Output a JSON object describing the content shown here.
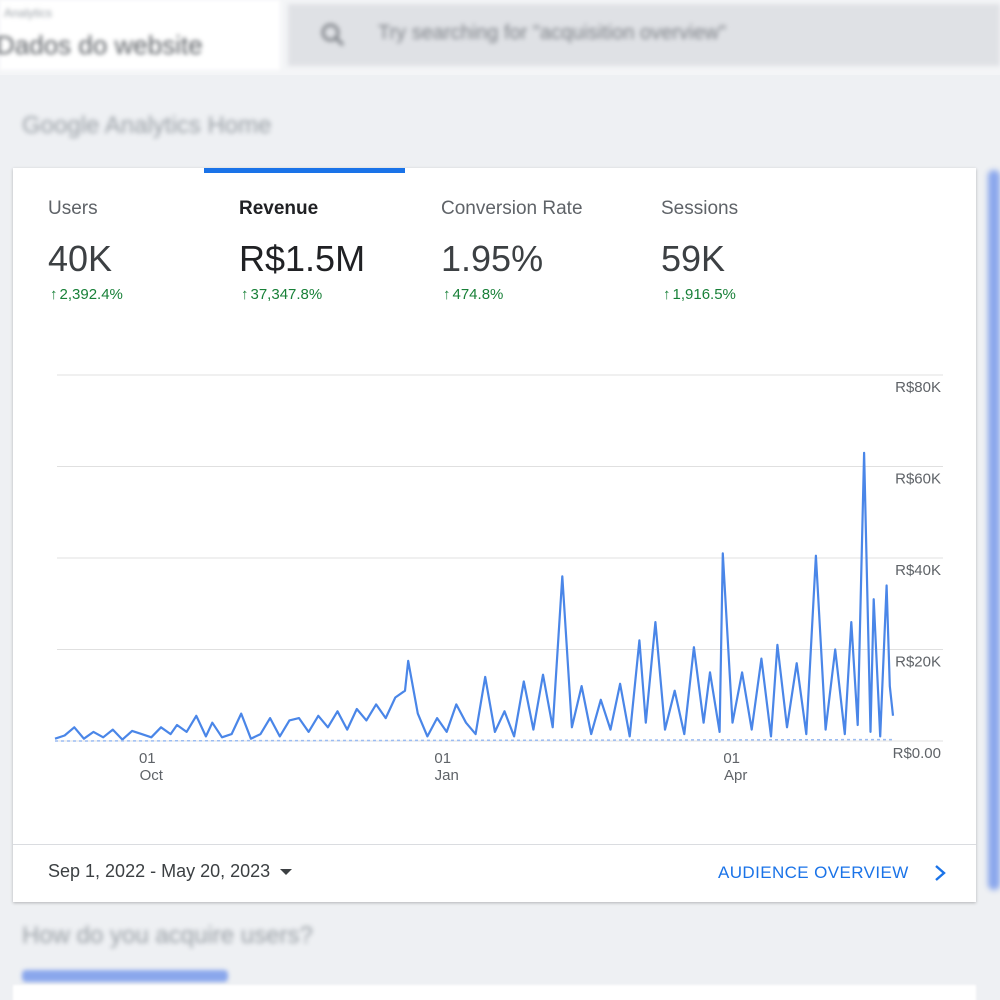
{
  "header": {
    "property_small": "Analytics",
    "property_name": "Dados do website",
    "search_placeholder": "Try searching for \"acquisition overview\""
  },
  "section_title": "Google Analytics Home",
  "metrics": [
    {
      "label": "Users",
      "value": "40K",
      "change": "2,392.4%",
      "active": false
    },
    {
      "label": "Revenue",
      "value": "R$1.5M",
      "change": "37,347.8%",
      "active": true
    },
    {
      "label": "Conversion Rate",
      "value": "1.95%",
      "change": "474.8%",
      "active": false
    },
    {
      "label": "Sessions",
      "value": "59K",
      "change": "1,916.5%",
      "active": false
    }
  ],
  "colors": {
    "accent": "#1a73e8",
    "line": "#4a86e8",
    "positive": "#188038"
  },
  "footer": {
    "date_range": "Sep 1, 2022 - May 20, 2023",
    "audience_link": "AUDIENCE OVERVIEW"
  },
  "bottom_section_title": "How do you acquire users?",
  "chart_data": {
    "type": "line",
    "title": "",
    "xlabel": "",
    "ylabel": "",
    "x_start": "2022-09-01",
    "x_end": "2023-05-20",
    "xticks": [
      {
        "date": "2022-10-01",
        "day": "01",
        "month": "Oct"
      },
      {
        "date": "2023-01-01",
        "day": "01",
        "month": "Jan"
      },
      {
        "date": "2023-04-01",
        "day": "01",
        "month": "Apr"
      }
    ],
    "yticks": [
      {
        "value": 0,
        "label": "R$0.00"
      },
      {
        "value": 20000,
        "label": "R$20K"
      },
      {
        "value": 40000,
        "label": "R$40K"
      },
      {
        "value": 60000,
        "label": "R$60K"
      },
      {
        "value": 80000,
        "label": "R$80K"
      }
    ],
    "ylim": [
      0,
      80000
    ],
    "grid": true,
    "series": [
      {
        "comparison": false,
        "points": [
          [
            "2022-09-01",
            500
          ],
          [
            "2022-09-04",
            1200
          ],
          [
            "2022-09-07",
            3000
          ],
          [
            "2022-09-10",
            500
          ],
          [
            "2022-09-13",
            2000
          ],
          [
            "2022-09-16",
            800
          ],
          [
            "2022-09-19",
            2500
          ],
          [
            "2022-09-22",
            300
          ],
          [
            "2022-09-25",
            2200
          ],
          [
            "2022-09-28",
            1500
          ],
          [
            "2022-10-01",
            800
          ],
          [
            "2022-10-04",
            3000
          ],
          [
            "2022-10-07",
            1500
          ],
          [
            "2022-10-09",
            3500
          ],
          [
            "2022-10-12",
            2000
          ],
          [
            "2022-10-15",
            5500
          ],
          [
            "2022-10-18",
            1000
          ],
          [
            "2022-10-20",
            4000
          ],
          [
            "2022-10-23",
            800
          ],
          [
            "2022-10-26",
            1500
          ],
          [
            "2022-10-29",
            6000
          ],
          [
            "2022-11-01",
            500
          ],
          [
            "2022-11-04",
            1500
          ],
          [
            "2022-11-07",
            5000
          ],
          [
            "2022-11-10",
            1000
          ],
          [
            "2022-11-13",
            4500
          ],
          [
            "2022-11-16",
            5000
          ],
          [
            "2022-11-19",
            2000
          ],
          [
            "2022-11-22",
            5500
          ],
          [
            "2022-11-25",
            3000
          ],
          [
            "2022-11-28",
            6500
          ],
          [
            "2022-12-01",
            2500
          ],
          [
            "2022-12-04",
            7000
          ],
          [
            "2022-12-07",
            4500
          ],
          [
            "2022-12-10",
            8000
          ],
          [
            "2022-12-13",
            5000
          ],
          [
            "2022-12-16",
            9500
          ],
          [
            "2022-12-19",
            11000
          ],
          [
            "2022-12-20",
            17500
          ],
          [
            "2022-12-23",
            6000
          ],
          [
            "2022-12-26",
            1000
          ],
          [
            "2022-12-29",
            5000
          ],
          [
            "2023-01-01",
            2000
          ],
          [
            "2023-01-04",
            8000
          ],
          [
            "2023-01-07",
            4000
          ],
          [
            "2023-01-10",
            1500
          ],
          [
            "2023-01-13",
            14000
          ],
          [
            "2023-01-16",
            2000
          ],
          [
            "2023-01-19",
            6500
          ],
          [
            "2023-01-22",
            1000
          ],
          [
            "2023-01-25",
            13000
          ],
          [
            "2023-01-28",
            2500
          ],
          [
            "2023-01-31",
            14500
          ],
          [
            "2023-02-03",
            3000
          ],
          [
            "2023-02-06",
            36000
          ],
          [
            "2023-02-09",
            3000
          ],
          [
            "2023-02-12",
            12000
          ],
          [
            "2023-02-15",
            1500
          ],
          [
            "2023-02-18",
            9000
          ],
          [
            "2023-02-21",
            2500
          ],
          [
            "2023-02-24",
            12500
          ],
          [
            "2023-02-27",
            1000
          ],
          [
            "2023-03-02",
            22000
          ],
          [
            "2023-03-04",
            4000
          ],
          [
            "2023-03-07",
            26000
          ],
          [
            "2023-03-10",
            2500
          ],
          [
            "2023-03-13",
            11000
          ],
          [
            "2023-03-16",
            1500
          ],
          [
            "2023-03-19",
            20500
          ],
          [
            "2023-03-22",
            4000
          ],
          [
            "2023-03-24",
            15000
          ],
          [
            "2023-03-27",
            2000
          ],
          [
            "2023-03-28",
            41000
          ],
          [
            "2023-03-31",
            4000
          ],
          [
            "2023-04-03",
            15000
          ],
          [
            "2023-04-06",
            2500
          ],
          [
            "2023-04-09",
            18000
          ],
          [
            "2023-04-12",
            1000
          ],
          [
            "2023-04-14",
            21000
          ],
          [
            "2023-04-17",
            3000
          ],
          [
            "2023-04-20",
            17000
          ],
          [
            "2023-04-23",
            1500
          ],
          [
            "2023-04-26",
            40500
          ],
          [
            "2023-04-29",
            2500
          ],
          [
            "2023-05-02",
            20000
          ],
          [
            "2023-05-05",
            1500
          ],
          [
            "2023-05-07",
            26000
          ],
          [
            "2023-05-09",
            3500
          ],
          [
            "2023-05-11",
            63000
          ],
          [
            "2023-05-13",
            2000
          ],
          [
            "2023-05-14",
            31000
          ],
          [
            "2023-05-16",
            1000
          ],
          [
            "2023-05-18",
            34000
          ],
          [
            "2023-05-19",
            12000
          ],
          [
            "2023-05-20",
            5500
          ]
        ]
      },
      {
        "comparison": true,
        "points": [
          [
            "2022-09-01",
            0
          ],
          [
            "2023-05-20",
            300
          ]
        ]
      }
    ]
  }
}
